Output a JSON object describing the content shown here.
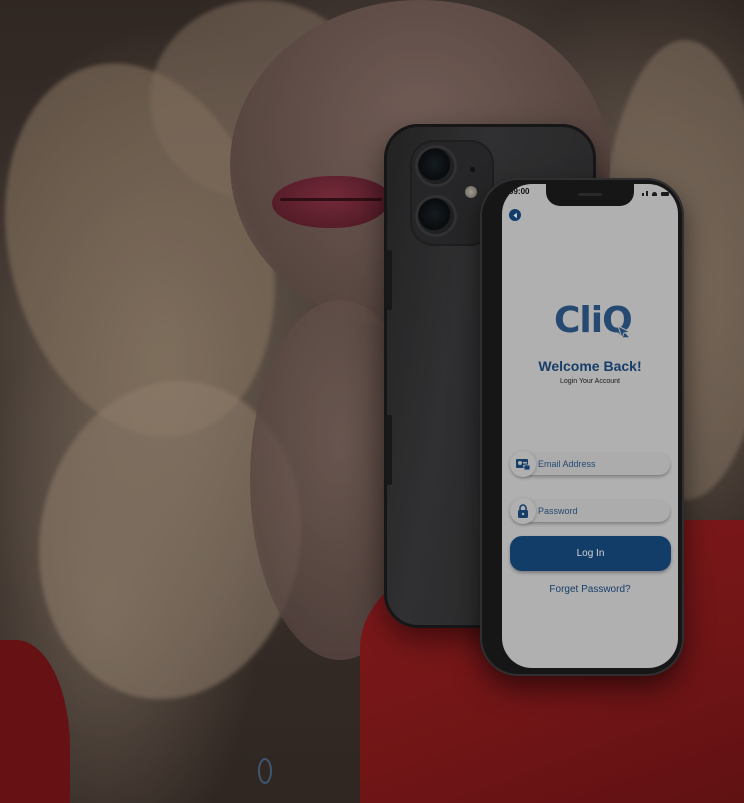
{
  "background": {
    "description_colors": {
      "sweater": "#9e1f22",
      "lips": "#8d3345"
    }
  },
  "status_bar": {
    "time": "09:00"
  },
  "app": {
    "logo_text": "CliQ",
    "welcome_title": "Welcome Back!",
    "welcome_subtitle": "Login Your Account",
    "email": {
      "placeholder": "Email Address",
      "value": "",
      "icon": "user-card-icon"
    },
    "password": {
      "placeholder": "Password",
      "value": "",
      "icon": "lock-icon"
    },
    "login_label": "Log In",
    "forgot_label": "Forget Password?"
  },
  "colors": {
    "accent": "#174b80",
    "screen_bg": "#d7d7d8",
    "logo": "#2e5a8a"
  }
}
